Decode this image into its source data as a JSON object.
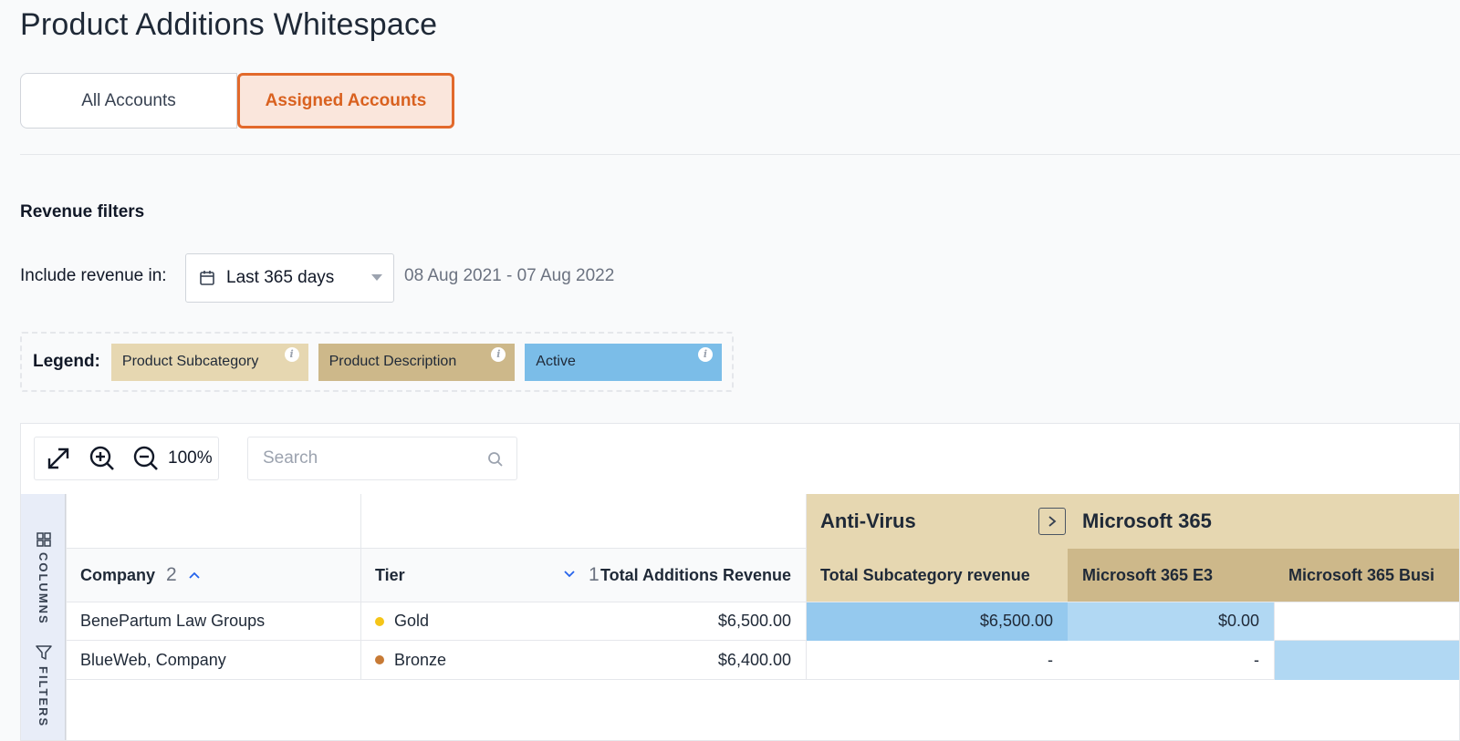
{
  "page": {
    "title": "Product Additions Whitespace"
  },
  "tabs": [
    {
      "label": "All Accounts",
      "active": false
    },
    {
      "label": "Assigned Accounts",
      "active": true
    }
  ],
  "revenue_filters": {
    "title": "Revenue filters",
    "include_label": "Include revenue in:",
    "range_selected": "Last 365 days",
    "date_range": "08 Aug 2021 - 07 Aug 2022"
  },
  "legend": {
    "label": "Legend:",
    "items": [
      {
        "label": "Product Subcategory",
        "color": "#e6d7b1"
      },
      {
        "label": "Product Description",
        "color": "#cdb88a"
      },
      {
        "label": "Active",
        "color": "#7bbde8"
      }
    ],
    "info_glyph": "i"
  },
  "toolbar": {
    "zoom_level": "100%",
    "search_placeholder": "Search"
  },
  "side_panel": {
    "columns_label": "COLUMNS",
    "filters_label": "FILTERS"
  },
  "grid": {
    "groups": {
      "anti_virus": "Anti-Virus",
      "microsoft_365": "Microsoft 365"
    },
    "headers": {
      "company": "Company",
      "company_sort_index": "2",
      "tier": "Tier",
      "revenue_sort_index": "1",
      "total_additions_revenue": "Total Additions Revenue",
      "total_subcategory_revenue": "Total Subcategory revenue",
      "ms365_e3": "Microsoft 365 E3",
      "ms365_business": "Microsoft 365 Busi"
    },
    "rows": [
      {
        "company": "BenePartum Law Groups",
        "tier": "Gold",
        "tier_color": "#f5c518",
        "total_additions_revenue": "$6,500.00",
        "total_subcategory_revenue": "$6,500.00",
        "ms365_e3": "$0.00",
        "ms365_business": ""
      },
      {
        "company": "BlueWeb, Company",
        "tier": "Bronze",
        "tier_color": "#c77a35",
        "total_additions_revenue": "$6,400.00",
        "total_subcategory_revenue": "-",
        "ms365_e3": "-",
        "ms365_business": ""
      }
    ]
  },
  "colors": {
    "accent": "#e2692b",
    "subcategory": "#e6d7b1",
    "description": "#cdb88a",
    "active_strong": "#95c9ee",
    "active_light": "#b1d8f3"
  }
}
